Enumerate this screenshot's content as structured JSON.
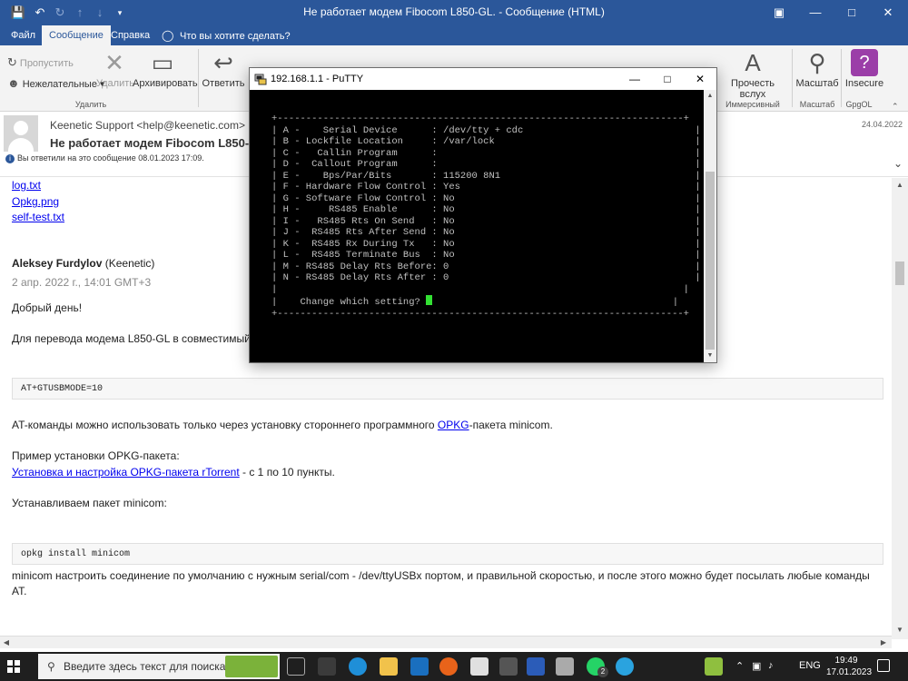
{
  "window": {
    "title": "Не работает модем Fibocom L850-GL.  -  Сообщение (HTML)"
  },
  "ribbon_tabs": [
    {
      "label": "Файл"
    },
    {
      "label": "Сообщение"
    },
    {
      "label": "Справка"
    }
  ],
  "tell_me": "Что вы хотите сделать?",
  "ribbon": {
    "skip": "Пропустить",
    "junk": "Нежелательные",
    "delete": "Удалить",
    "archive": "Архивировать",
    "reply": "Ответить",
    "group_delete": "Удалить",
    "read_aloud_line1": "Прочесть",
    "read_aloud_line2": "вслух",
    "group_immersive": "Иммерсивный режим",
    "zoom": "Масштаб",
    "group_zoom": "Масштаб",
    "insecure": "Insecure",
    "group_gpgol": "GpgOL"
  },
  "message": {
    "sender": "Keenetic Support <help@keenetic.com>",
    "subject": "Не работает модем Fibocom L850-GL.",
    "date": "24.04.2022",
    "info": "Вы ответили на это сообщение 08.01.2023 17:09."
  },
  "attachments": [
    "log.txt",
    "Opkg.png",
    "self-test.txt"
  ],
  "body": {
    "author_name": "Aleksey Furdylov",
    "author_org": "(Keenetic)",
    "author_date": "2 апр. 2022 г., 14:01 GMT+3",
    "greeting": "Добрый день!",
    "para1": "Для перевода модема L850-GL в совместимый",
    "code1": "AT+GTUSBMODE=10",
    "para2_pre": "AT-команды можно использовать только через установку стороннего программного ",
    "para2_link": "OPKG",
    "para2_post": "-пакета minicom.",
    "para3": "Пример установки OPKG-пакета:",
    "para3_link": "Установка и настройка OPKG-пакета rTorrent",
    "para3_post": " - с 1 по 10 пункты.",
    "para4": "Устанавливаем пакет minicom:",
    "code2": "opkg install minicom",
    "para5_line1": "minicom  настроить соединение по умолчанию с нужным serial/com - /dev/ttyUSBx портом, и правильной скоростью, и после этого можно будет посылать любые команды",
    "para5_line2": "AT."
  },
  "putty": {
    "title": "192.168.1.1 - PuTTY",
    "terminal": "+-----------------------------------------------------------------------+\n| A -    Serial Device      : /dev/tty + cdc                              |\n| B - Lockfile Location     : /var/lock                                   |\n| C -   Callin Program      :                                             |\n| D -  Callout Program      :                                             |\n| E -    Bps/Par/Bits       : 115200 8N1                                  |\n| F - Hardware Flow Control : Yes                                         |\n| G - Software Flow Control : No                                          |\n| H -     RS485 Enable      : No                                          |\n| I -   RS485 Rts On Send   : No                                          |\n| J -  RS485 Rts After Send : No                                          |\n| K -  RS485 Rx During Tx   : No                                          |\n| L -  RS485 Terminate Bus  : No                                          |\n| M - RS485 Delay Rts Before: 0                                           |\n| N - RS485 Delay Rts After : 0                                           |\n|                                                                       |\n|    Change which setting? ",
    "terminal_tail": "                                          |\n+-----------------------------------------------------------------------+"
  },
  "taskbar": {
    "search_placeholder": "Введите здесь текст для поиска",
    "lang": "ENG",
    "time": "19:49",
    "date": "17.01.2023",
    "whatsapp_badge": "2"
  },
  "colors": {
    "accent": "#2b579a",
    "link": "#0000ee",
    "terminal_bg": "#000000",
    "terminal_fg": "#c0c0c0",
    "cursor": "#33e033",
    "taskbar": "#1f1f1f"
  }
}
